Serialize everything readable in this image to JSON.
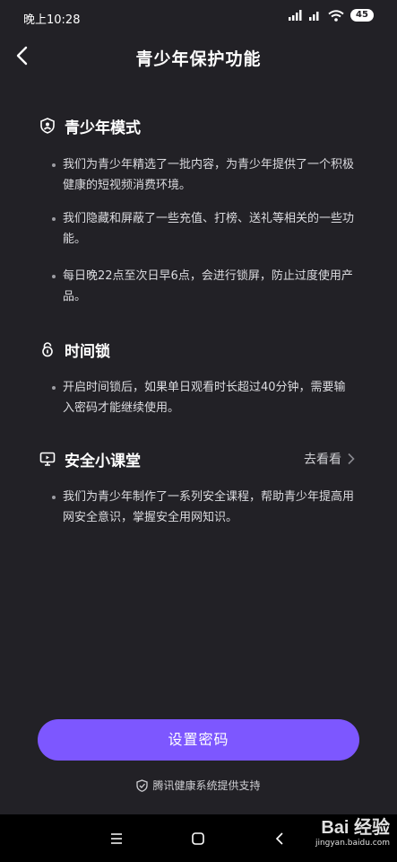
{
  "status_bar": {
    "time": "晚上10:28",
    "battery": "45",
    "icons": [
      "signal-icon",
      "signal-hd-icon",
      "wifi-icon",
      "battery-icon"
    ]
  },
  "header": {
    "title": "青少年保护功能",
    "back_icon": "chevron-left-icon"
  },
  "sections": [
    {
      "title": "青少年模式",
      "icon": "shield-user-icon",
      "bullets": [
        "我们为青少年精选了一批内容，为青少年提供了一个积极健康的短视频消费环境。",
        "我们隐藏和屏蔽了一些充值、打榜、送礼等相关的一些功能。",
        "每日晚22点至次日早6点，会进行锁屏，防止过度使用产品。"
      ]
    },
    {
      "title": "时间锁",
      "icon": "lock-icon",
      "bullets": [
        "开启时间锁后，如果单日观看时长超过40分钟，需要输入密码才能继续使用。"
      ]
    },
    {
      "title": "安全小课堂",
      "icon": "monitor-play-icon",
      "link_label": "去看看",
      "bullets": [
        "我们为青少年制作了一系列安全课程，帮助青少年提高用网安全意识，掌握安全用网知识。"
      ]
    }
  ],
  "primary_button": {
    "label": "设置密码",
    "color": "#7d57ff"
  },
  "footer": {
    "text": "腾讯健康系统提供支持",
    "icon": "shield-icon"
  },
  "watermark": {
    "logo": "Bai 经验",
    "url": "jingyan.baidu.com"
  },
  "colors": {
    "background": "#222126",
    "accent": "#7d57ff",
    "nav_bar": "#000000"
  }
}
